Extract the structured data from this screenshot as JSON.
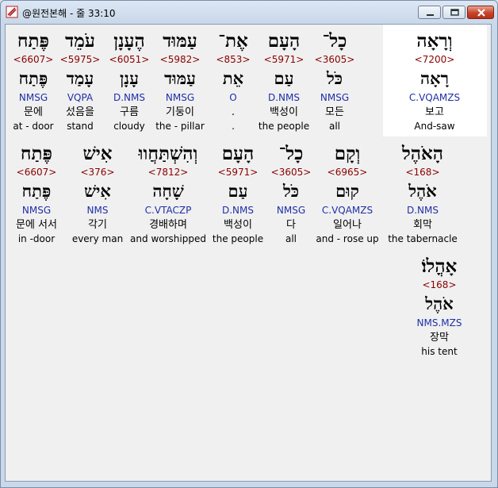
{
  "window": {
    "title": "@원전본해 - 줄 33:10"
  },
  "rows": [
    [
      {
        "heb": "וְרָאָה",
        "strong": "<7200>",
        "root": "רָאָה",
        "morph": "C.VQAMZS",
        "kor": "보고",
        "eng": "And-saw"
      },
      {
        "heb": "כָל־",
        "strong": "<3605>",
        "root": "כֹּל",
        "morph": "NMSG",
        "kor": "모든",
        "eng": "all"
      },
      {
        "heb": "הָעָם",
        "strong": "<5971>",
        "root": "עַם",
        "morph": "D.NMS",
        "kor": "백성이",
        "eng": "the people"
      },
      {
        "heb": "אֶת־",
        "strong": "<853>",
        "root": "אֵת",
        "morph": "O",
        "kor": ".",
        "eng": "."
      },
      {
        "heb": "עַמּוּד",
        "strong": "<5982>",
        "root": "עַמּוּד",
        "morph": "NMSG",
        "kor": "기둥이",
        "eng": "the - pillar"
      },
      {
        "heb": "הֶעָנָן",
        "strong": "<6051>",
        "root": "עָנָן",
        "morph": "D.NMS",
        "kor": "구름",
        "eng": "cloudy"
      },
      {
        "heb": "עֹמֵד",
        "strong": "<5975>",
        "root": "עָמַד",
        "morph": "VQPA",
        "kor": "섰음을",
        "eng": "stand"
      },
      {
        "heb": "פֶּתַח",
        "strong": "<6607>",
        "root": "פֶּתַח",
        "morph": "NMSG",
        "kor": "문에",
        "eng": "at - door"
      }
    ],
    [
      {
        "heb": "הָאֹהֶל",
        "strong": "<168>",
        "root": "אֹהֶל",
        "morph": "D.NMS",
        "kor": "회막",
        "eng": "the tabernacle"
      },
      {
        "heb": "וְקָם",
        "strong": "<6965>",
        "root": "קוּם",
        "morph": "C.VQAMZS",
        "kor": "일어나",
        "eng": "and - rose up"
      },
      {
        "heb": "כָל־",
        "strong": "<3605>",
        "root": "כֹּל",
        "morph": "NMSG",
        "kor": "다",
        "eng": "all"
      },
      {
        "heb": "הָעָם",
        "strong": "<5971>",
        "root": "עַם",
        "morph": "D.NMS",
        "kor": "백성이",
        "eng": "the people"
      },
      {
        "heb": "וְהִשְׁתַּחֲווּ",
        "strong": "<7812>",
        "root": "שָׁחָה",
        "morph": "C.VTACZP",
        "kor": "경배하며",
        "eng": "and worshipped"
      },
      {
        "heb": "אִישׁ",
        "strong": "<376>",
        "root": "אִישׁ",
        "morph": "NMS",
        "kor": "각기",
        "eng": "every man"
      },
      {
        "heb": "פֶּתַח",
        "strong": "<6607>",
        "root": "פֶּתַח",
        "morph": "NMSG",
        "kor": "문에 서서",
        "eng": "in -door"
      }
    ],
    [
      {
        "heb": "אָהֳלוֹ׃",
        "strong": "<168>",
        "root": "אֹהֶל",
        "morph": "NMS.MZS",
        "kor": "장막",
        "eng": "his tent"
      }
    ]
  ],
  "colors": {
    "strong": "#8b0000",
    "morph": "#1f2fa8",
    "highlight": "#ffffff",
    "background": "#f0f0f0"
  }
}
